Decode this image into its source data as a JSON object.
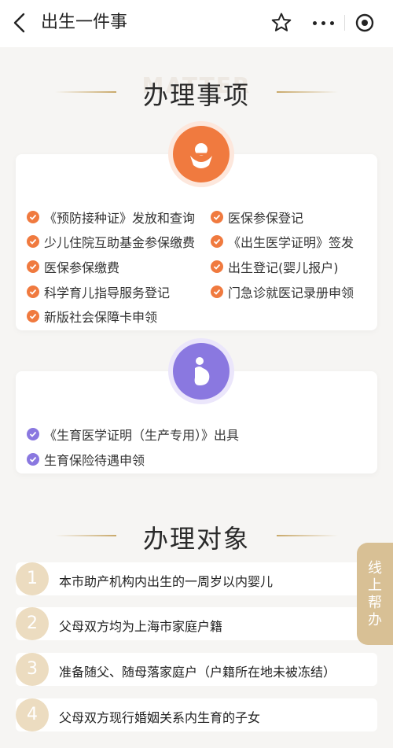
{
  "nav": {
    "title": "出生一件事"
  },
  "section_matters": {
    "title": "办理事项",
    "ghost": "MATTER"
  },
  "card1": {
    "items": [
      "《预防接种证》发放和查询",
      "医保参保登记",
      "少儿住院互助基金参保缴费",
      "《出生医学证明》签发",
      "医保参保缴费",
      "出生登记(婴儿报户)",
      "科学育儿指导服务登记",
      "门急诊就医记录册申领",
      "新版社会保障卡申领"
    ]
  },
  "card2": {
    "items": [
      "《生育医学证明（生产专用）》出具",
      "生育保险待遇申领"
    ]
  },
  "section_targets": {
    "title": "办理对象"
  },
  "targets": [
    {
      "num": "1",
      "text": "本市助产机构内出生的一周岁以内婴儿"
    },
    {
      "num": "2",
      "text": "父母双方均为上海市家庭户籍"
    },
    {
      "num": "3",
      "text": "准备随父、随母落家庭户（户籍所在地未被冻结）"
    },
    {
      "num": "4",
      "text": "父母双方现行婚姻关系内生育的子女"
    }
  ],
  "side_help": {
    "c1": "线",
    "c2": "上",
    "c3": "帮",
    "c4": "办"
  },
  "colors": {
    "orange": "#f07a3f",
    "purple": "#8a78e0",
    "gold": "#d8c095"
  }
}
